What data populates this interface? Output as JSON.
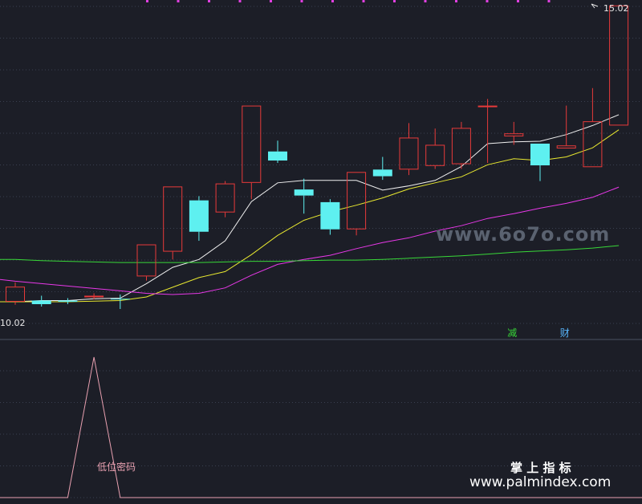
{
  "chart_data": [
    {
      "type": "candlestick",
      "price_high_label": "15.02",
      "price_low_label": "10.02",
      "ylim": [
        10.02,
        15.02
      ],
      "grid": true,
      "candles": [
        {
          "o": 10.1,
          "c": 10.35,
          "h": 10.42,
          "l": 10.05
        },
        {
          "o": 10.12,
          "c": 10.06,
          "h": 10.2,
          "l": 10.02
        },
        {
          "o": 10.12,
          "c": 10.1,
          "h": 10.16,
          "l": 10.06
        },
        {
          "o": 10.18,
          "c": 10.2,
          "h": 10.24,
          "l": 10.14
        },
        {
          "o": 10.15,
          "c": 10.14,
          "h": 10.22,
          "l": 9.98
        },
        {
          "o": 10.52,
          "c": 11.05,
          "h": 11.05,
          "l": 10.45
        },
        {
          "o": 10.93,
          "c": 12.01,
          "h": 12.01,
          "l": 10.8
        },
        {
          "o": 11.78,
          "c": 11.26,
          "h": 11.85,
          "l": 11.11
        },
        {
          "o": 11.58,
          "c": 12.06,
          "h": 12.1,
          "l": 11.5
        },
        {
          "o": 12.07,
          "c": 13.35,
          "h": 13.35,
          "l": 11.8
        },
        {
          "o": 12.59,
          "c": 12.44,
          "h": 12.77,
          "l": 12.4
        },
        {
          "o": 11.96,
          "c": 11.86,
          "h": 12.14,
          "l": 11.56
        },
        {
          "o": 11.75,
          "c": 11.3,
          "h": 11.8,
          "l": 11.21
        },
        {
          "o": 11.3,
          "c": 12.25,
          "h": 12.25,
          "l": 11.2
        },
        {
          "o": 12.29,
          "c": 12.18,
          "h": 12.5,
          "l": 12.12
        },
        {
          "o": 12.29,
          "c": 12.82,
          "h": 13.06,
          "l": 12.2
        },
        {
          "o": 12.35,
          "c": 12.7,
          "h": 12.97,
          "l": 12.3
        },
        {
          "o": 12.38,
          "c": 12.98,
          "h": 13.08,
          "l": 12.3
        },
        {
          "o": 13.35,
          "c": 13.35,
          "h": 13.46,
          "l": 12.4
        },
        {
          "o": 12.84,
          "c": 12.89,
          "h": 13.08,
          "l": 12.7
        },
        {
          "o": 12.72,
          "c": 12.36,
          "h": 12.72,
          "l": 12.1
        },
        {
          "o": 12.64,
          "c": 12.69,
          "h": 13.35,
          "l": 12.64
        },
        {
          "o": 12.33,
          "c": 13.09,
          "h": 13.64,
          "l": 12.33
        },
        {
          "o": 13.02,
          "c": 15.01,
          "h": 15.02,
          "l": 13.02
        }
      ],
      "ma_lines": [
        {
          "color": "#f0f0f0",
          "values": [
            10.1,
            10.12,
            10.12,
            10.15,
            10.16,
            10.4,
            10.67,
            10.8,
            11.11,
            11.76,
            12.07,
            12.11,
            12.11,
            12.11,
            11.95,
            12.02,
            12.11,
            12.34,
            12.72,
            12.75,
            12.76,
            12.87,
            13.02,
            13.2
          ]
        },
        {
          "color": "#e8e830",
          "values": [
            10.1,
            10.1,
            10.1,
            10.11,
            10.12,
            10.18,
            10.34,
            10.5,
            10.6,
            10.88,
            11.2,
            11.45,
            11.59,
            11.7,
            11.82,
            11.97,
            12.07,
            12.17,
            12.37,
            12.47,
            12.44,
            12.5,
            12.65,
            12.95
          ]
        },
        {
          "color": "#e838e8",
          "values": [
            10.44,
            10.4,
            10.36,
            10.32,
            10.28,
            10.24,
            10.22,
            10.24,
            10.33,
            10.54,
            10.72,
            10.8,
            10.87,
            10.98,
            11.08,
            11.16,
            11.27,
            11.36,
            11.48,
            11.56,
            11.65,
            11.73,
            11.83,
            12.0
          ]
        },
        {
          "color": "#38d838",
          "values": [
            10.8,
            10.78,
            10.77,
            10.76,
            10.75,
            10.75,
            10.75,
            10.75,
            10.76,
            10.77,
            10.77,
            10.78,
            10.79,
            10.79,
            10.8,
            10.82,
            10.84,
            10.86,
            10.89,
            10.92,
            10.94,
            10.96,
            10.99,
            11.03
          ]
        }
      ],
      "markers": [
        {
          "index": 19,
          "text": "减",
          "color": "#38d838"
        },
        {
          "index": 21,
          "text": "财",
          "color": "#58b8ff"
        }
      ]
    },
    {
      "type": "line",
      "series": [
        {
          "color": "#e8a0b0",
          "values": [
            0,
            0,
            0,
            1,
            0,
            0,
            0,
            0,
            0,
            0,
            0,
            0,
            0,
            0,
            0,
            0,
            0,
            0,
            0,
            0,
            0,
            0,
            0,
            0
          ]
        }
      ],
      "ylim": [
        0,
        1
      ],
      "label": "低位密码"
    }
  ],
  "watermarks": {
    "center": "www.6o7o.com",
    "brand": "掌 上 指 标",
    "site": "www.palmindex.com"
  },
  "colors": {
    "background": "#1c1e27",
    "up": "#e83a3a",
    "down": "#5ef0f0",
    "grid": "#3a4050",
    "purple_tick": "#e040e0"
  }
}
